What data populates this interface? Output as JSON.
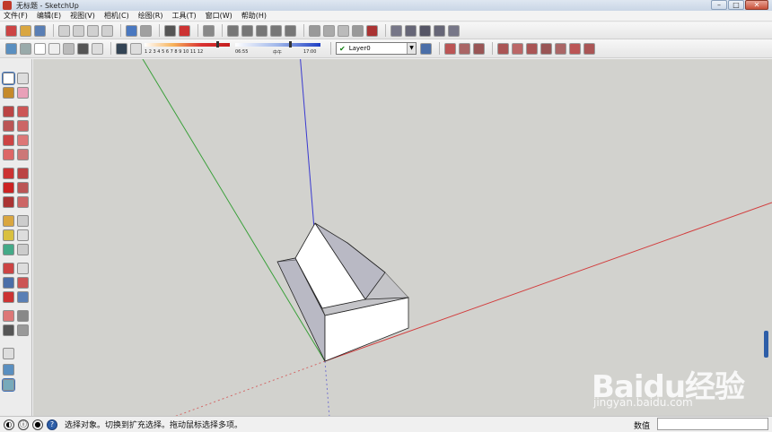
{
  "window": {
    "title": "无标题 - SketchUp",
    "minimize": "–",
    "maximize": "□",
    "close": "✕"
  },
  "menu": [
    "文件(F)",
    "编辑(E)",
    "视图(V)",
    "相机(C)",
    "绘图(R)",
    "工具(T)",
    "窗口(W)",
    "帮助(H)"
  ],
  "shadow": {
    "month_ticks": "1 2 3 4 5 6 7 8 9 10 11 12",
    "time_start": "06:55",
    "time_mid": "中午",
    "time_end": "17:00"
  },
  "layer": {
    "current": "Layer0"
  },
  "status": {
    "hint": "选择对象。切换到扩充选择。拖动鼠标选择多项。",
    "measure_label": "数值",
    "measure_value": ""
  },
  "watermark": {
    "brand": "Baidu经验",
    "url": "jingyan.baidu.com"
  },
  "icons": [
    "select-icon",
    "eraser-icon",
    "paint-bucket-icon",
    "rectangle-icon",
    "line-icon",
    "circle-icon",
    "arc-icon",
    "polygon-icon",
    "freehand-icon",
    "move-icon",
    "push-pull-icon",
    "rotate-icon",
    "follow-me-icon",
    "scale-icon",
    "offset-icon",
    "tape-measure-icon",
    "dimension-icon",
    "protractor-icon",
    "text-icon",
    "axes-icon",
    "3d-text-icon",
    "orbit-icon",
    "pan-icon",
    "zoom-icon",
    "zoom-window-icon",
    "zoom-extents-icon",
    "previous-view-icon",
    "position-camera-icon",
    "walk-icon",
    "look-around-icon",
    "section-plane-icon"
  ],
  "colors": {
    "viewport_bg": "#d2d2ce",
    "axis_red": "#d23c3c",
    "axis_green": "#3aa03a",
    "axis_blue": "#3a3ad0",
    "face_front": "#ffffff",
    "face_shaded": "#b9b9c4"
  }
}
